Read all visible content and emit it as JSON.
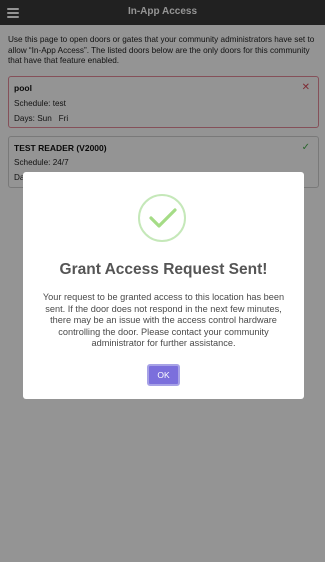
{
  "header": {
    "title": "In-App Access",
    "menu_icon": "hamburger-menu-icon"
  },
  "intro_text": "Use this page to open doors or gates that your community administrators have set to allow “In-App Access”. The listed doors below are the only doors for this community that have that feature enabled.",
  "doors": [
    {
      "name": "pool",
      "schedule": "Schedule: test",
      "days_label": "Days:",
      "days": "Sun   Fri",
      "status": "denied",
      "status_icon": "close-x-icon",
      "status_color": "#d94a5a"
    },
    {
      "name": "TEST READER (V2000)",
      "schedule": "Schedule: 24/7",
      "days_label": "Da",
      "status": "allowed",
      "status_icon": "check-icon",
      "status_color": "#4caf50"
    }
  ],
  "modal": {
    "icon": "success-check-icon",
    "icon_color": "#a5dc86",
    "title": "Grant Access Request Sent!",
    "message": "Your request to be granted access to this location has been sent. If the door does not respond in the next few minutes, there may be an issue with the access control hardware controlling the door. Please contact your community administrator for further assistance.",
    "ok_label": "OK",
    "ok_color": "#7b6fdc"
  }
}
